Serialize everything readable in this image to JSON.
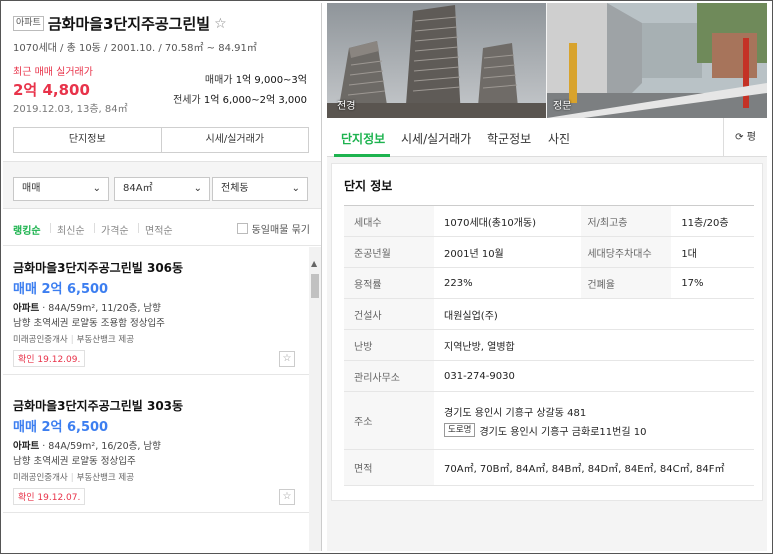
{
  "listing_header": {
    "type_badge": "아파트",
    "title": "금화마을3단지주공그린빌",
    "favorite_icon": "star-outline-icon",
    "summary": "1070세대 / 총 10동 / 2001.10. / 70.58㎡ ~ 84.91㎡"
  },
  "recent_trade": {
    "label": "최근 매매 실거래가",
    "price": "2억 4,800",
    "date": "2019.12.03, 13층, 84㎡"
  },
  "price_range": {
    "sale_label": "매매가",
    "sale_value": "1억 9,000~3억",
    "jeonse_label": "전세가",
    "jeonse_value": "1억 6,000~2억 3,000"
  },
  "left_tabs": [
    "단지정보",
    "시세/실거래가"
  ],
  "filters": {
    "trade_type": "매매",
    "area": "84A㎡",
    "building": "전체동",
    "chevron_icon": "chevron-down-icon"
  },
  "sort": {
    "options": [
      "랭킹순",
      "최신순",
      "가격순",
      "면적순"
    ],
    "active": "랭킹순",
    "group_label": "동일매물 묶기"
  },
  "listings": [
    {
      "name": "금화마을3단지주공그린빌 306동",
      "price": "매매 2억 6,500",
      "spec_type": "아파트",
      "spec": "84A/59m², 11/20층, 남향",
      "desc": "남향 초역세권 로얄동 조용함 정상입주",
      "agency": "미래공인중개사",
      "provider": "부동산뱅크 제공",
      "confirm": "확인 19.12.09."
    },
    {
      "name": "금화마을3단지주공그린빌 303동",
      "price": "매매 2억 6,500",
      "spec_type": "아파트",
      "spec": "84A/59m², 16/20층, 남향",
      "desc": "남향 초역세권 로얄동 정상입주",
      "agency": "미래공인중개사",
      "provider": "부동산뱅크 제공",
      "confirm": "확인 19.12.07."
    }
  ],
  "photos": [
    {
      "caption": "전경"
    },
    {
      "caption": "정문"
    }
  ],
  "right_tabs": {
    "items": [
      "단지정보",
      "시세/실거래가",
      "학군정보",
      "사진"
    ],
    "active": "단지정보",
    "share_icon": "refresh-icon",
    "share_label": "평"
  },
  "complex_info": {
    "title": "단지 정보",
    "rows": [
      {
        "k1": "세대수",
        "v1": "1070세대(총10개동)",
        "k2": "저/최고층",
        "v2": "11층/20층"
      },
      {
        "k1": "준공년월",
        "v1": "2001년 10월",
        "k2": "세대당주차대수",
        "v2": "1대"
      },
      {
        "k1": "용적률",
        "v1": "223%",
        "k2": "건폐율",
        "v2": "17%"
      }
    ],
    "builder_label": "건설사",
    "builder": "대원실업(주)",
    "heating_label": "난방",
    "heating": "지역난방, 열병합",
    "office_label": "관리사무소",
    "office_phone": "031-274-9030",
    "address_label": "주소",
    "address": "경기도 용인시 기흥구 상갈동 481",
    "road_badge": "도로명",
    "road_address": "경기도 용인시 기흥구 금화로11번길 10",
    "area_label": "면적",
    "areas": "70A㎡, 70B㎡, 84A㎡, 84B㎡, 84D㎡, 84E㎡, 84C㎡, 84F㎡"
  }
}
